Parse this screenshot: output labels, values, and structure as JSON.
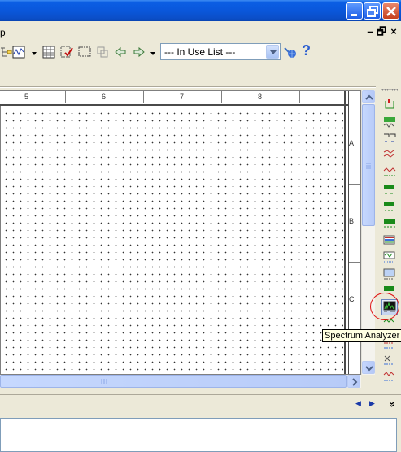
{
  "titlebar": {
    "buttons": [
      "minimize",
      "restore",
      "close"
    ],
    "color": "#0a56d9"
  },
  "menubar": {
    "partial_menu": "p",
    "mdi_buttons": [
      "–",
      "🗗",
      "×"
    ]
  },
  "toolbar": {
    "combo_value": "--- In Use List ---",
    "help_symbol": "?"
  },
  "ruler": {
    "top_labels": [
      "5",
      "6",
      "7",
      "8"
    ],
    "right_labels": [
      "A",
      "B",
      "C"
    ]
  },
  "component_toolbar": {
    "icons": [
      "source-icon",
      "power-source-icon",
      "basic-icon",
      "diode-icon",
      "transistor-icon",
      "analog-icon",
      "ttl-icon",
      "cmos-icon",
      "misc-digital-icon",
      "mixed-icon",
      "indicator-icon",
      "misc-icon",
      "rf-icon",
      "spectrum-analyzer-icon",
      "network-analyzer-icon",
      "instrument-icon",
      "labview-icon",
      "measurement-icon"
    ],
    "tooltip": "Spectrum Analyzer",
    "highlight_color": "#e01010"
  },
  "statusbar": {
    "nav_prev": "◀",
    "nav_next": "▶",
    "expand": "»"
  }
}
